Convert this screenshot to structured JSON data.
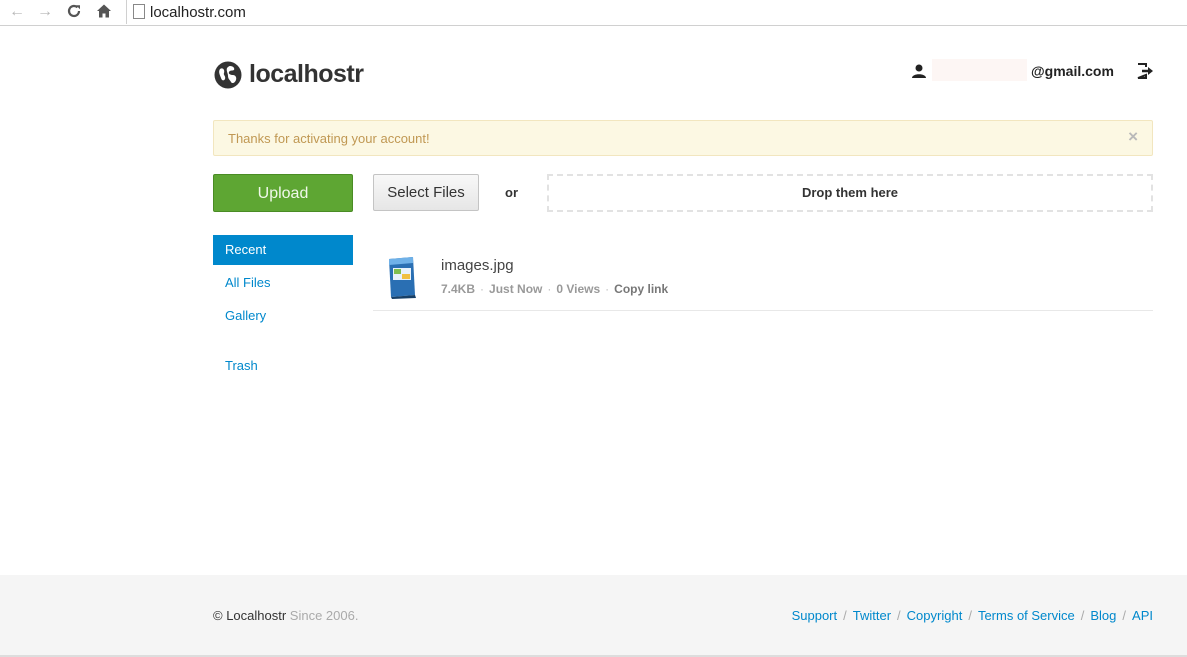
{
  "browser": {
    "url": "localhostr.com",
    "back_icon": "arrow-left-icon",
    "forward_icon": "arrow-right-icon",
    "reload_icon": "reload-icon",
    "home_icon": "home-icon"
  },
  "header": {
    "brand": "localhostr",
    "user_email": "@gmail.com"
  },
  "alert": {
    "message": "Thanks for activating your account!",
    "close": "×"
  },
  "upload": {
    "upload_label": "Upload",
    "select_label": "Select Files",
    "or_label": "or",
    "drop_label": "Drop them here"
  },
  "sidebar": {
    "items": [
      {
        "label": "Recent",
        "active": true
      },
      {
        "label": "All Files"
      },
      {
        "label": "Gallery"
      },
      {
        "label": "Trash"
      }
    ]
  },
  "files": [
    {
      "name": "images.jpg",
      "size": "7.4KB",
      "time": "Just Now",
      "views": "0 Views",
      "action": "Copy link"
    }
  ],
  "footer": {
    "copyright": "© Localhostr",
    "since": "Since 2006.",
    "links": [
      "Support",
      "Twitter",
      "Copyright",
      "Terms of Service",
      "Blog",
      "API"
    ],
    "separator": "/"
  },
  "colors": {
    "accent": "#0088cc",
    "upload_green": "#5ea633",
    "alert_bg": "#fcf8e3",
    "alert_text": "#c09853"
  }
}
